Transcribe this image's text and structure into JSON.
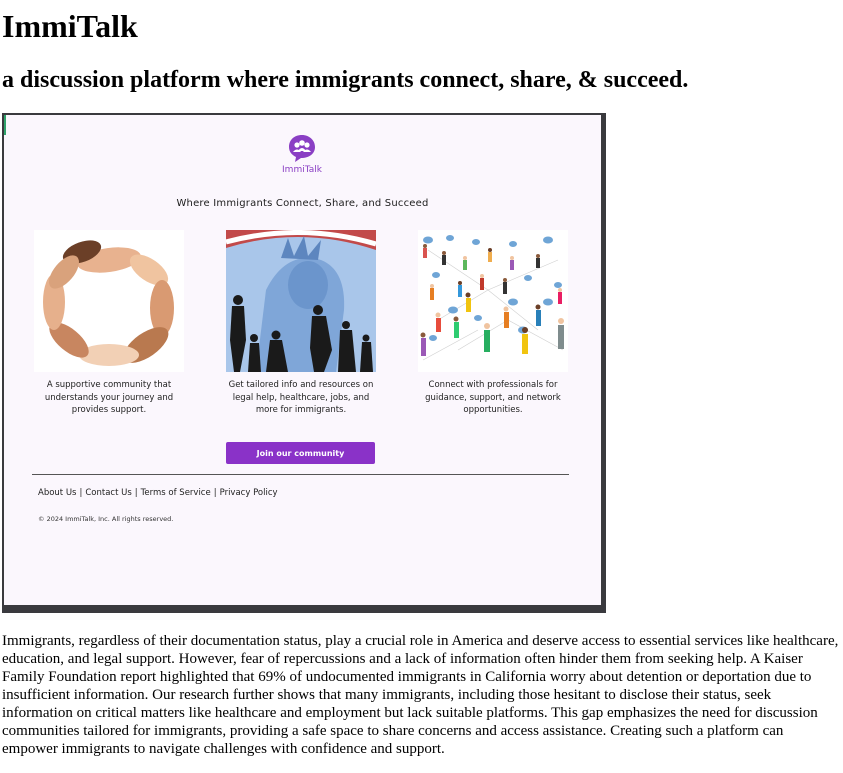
{
  "page": {
    "title": "ImmiTalk",
    "subtitle": "a discussion platform where immigrants connect, share, & succeed."
  },
  "mockup": {
    "logo_text": "ImmiTalk",
    "tagline": "Where Immigrants Connect, Share, and Succeed",
    "cards": [
      {
        "caption": "A supportive community that understands your journey and provides support.",
        "image": "hands-circle-image"
      },
      {
        "caption": "Get tailored info and resources on legal help, healthcare, jobs, and more for immigrants.",
        "image": "statue-of-liberty-image"
      },
      {
        "caption": "Connect with professionals for guidance, support, and network opportunities.",
        "image": "people-network-image"
      }
    ],
    "join_button": "Join our community",
    "footer_links": [
      "About Us",
      "Contact Us",
      "Terms of Service",
      "Privacy Policy"
    ],
    "copyright": "© 2024 ImmiTalk, Inc. All rights reserved.",
    "colors": {
      "brand": "#8a32c8",
      "background": "#fbf7fd",
      "frame": "#3a3a3e"
    }
  },
  "body_text": "Immigrants, regardless of their documentation status, play a crucial role in America and deserve access to essential services like healthcare, education, and legal support. However, fear of repercussions and a lack of information often hinder them from seeking help. A Kaiser Family Foundation report highlighted that 69% of undocumented immigrants in California worry about detention or deportation due to insufficient information. Our research further shows that many immigrants, including those hesitant to disclose their status, seek information on critical matters like healthcare and employment but lack suitable platforms. This gap emphasizes the need for discussion communities tailored for immigrants, providing a safe space to share concerns and access assistance. Creating such a platform can empower immigrants to navigate challenges with confidence and support."
}
